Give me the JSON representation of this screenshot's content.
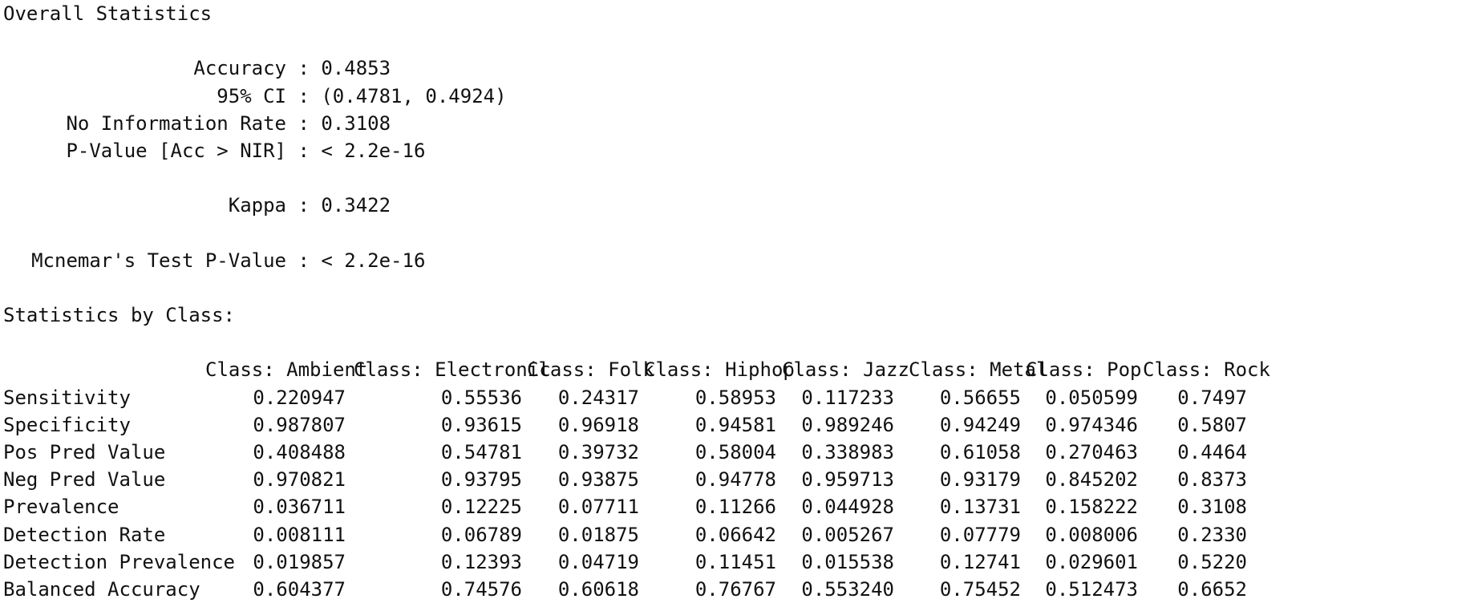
{
  "overall": {
    "heading": "Overall Statistics",
    "items": [
      {
        "label": "Accuracy",
        "value": "0.4853"
      },
      {
        "label": "95% CI",
        "value": "(0.4781, 0.4924)"
      },
      {
        "label": "No Information Rate",
        "value": "0.3108"
      },
      {
        "label": "P-Value [Acc > NIR]",
        "value": "< 2.2e-16"
      },
      {
        "label": "Kappa",
        "value": "0.3422"
      },
      {
        "label": "Mcnemar's Test P-Value",
        "value": "< 2.2e-16"
      }
    ]
  },
  "by_class": {
    "heading": "Statistics by Class:",
    "columns": [
      "Class: Ambient",
      "Class: Electronic",
      "Class: Folk",
      "Class: Hiphop",
      "Class: Jazz",
      "Class: Metal",
      "Class: Pop",
      "Class: Rock"
    ],
    "rows": [
      {
        "name": "Sensitivity",
        "values": [
          "0.220947",
          "0.55536",
          "0.24317",
          "0.58953",
          "0.117233",
          "0.56655",
          "0.050599",
          "0.7497"
        ]
      },
      {
        "name": "Specificity",
        "values": [
          "0.987807",
          "0.93615",
          "0.96918",
          "0.94581",
          "0.989246",
          "0.94249",
          "0.974346",
          "0.5807"
        ]
      },
      {
        "name": "Pos Pred Value",
        "values": [
          "0.408488",
          "0.54781",
          "0.39732",
          "0.58004",
          "0.338983",
          "0.61058",
          "0.270463",
          "0.4464"
        ]
      },
      {
        "name": "Neg Pred Value",
        "values": [
          "0.970821",
          "0.93795",
          "0.93875",
          "0.94778",
          "0.959713",
          "0.93179",
          "0.845202",
          "0.8373"
        ]
      },
      {
        "name": "Prevalence",
        "values": [
          "0.036711",
          "0.12225",
          "0.07711",
          "0.11266",
          "0.044928",
          "0.13731",
          "0.158222",
          "0.3108"
        ]
      },
      {
        "name": "Detection Rate",
        "values": [
          "0.008111",
          "0.06789",
          "0.01875",
          "0.06642",
          "0.005267",
          "0.07779",
          "0.008006",
          "0.2330"
        ]
      },
      {
        "name": "Detection Prevalence",
        "values": [
          "0.019857",
          "0.12393",
          "0.04719",
          "0.11451",
          "0.015538",
          "0.12741",
          "0.029601",
          "0.5220"
        ]
      },
      {
        "name": "Balanced Accuracy",
        "values": [
          "0.604377",
          "0.74576",
          "0.60618",
          "0.76767",
          "0.553240",
          "0.75452",
          "0.512473",
          "0.6652"
        ]
      }
    ]
  }
}
